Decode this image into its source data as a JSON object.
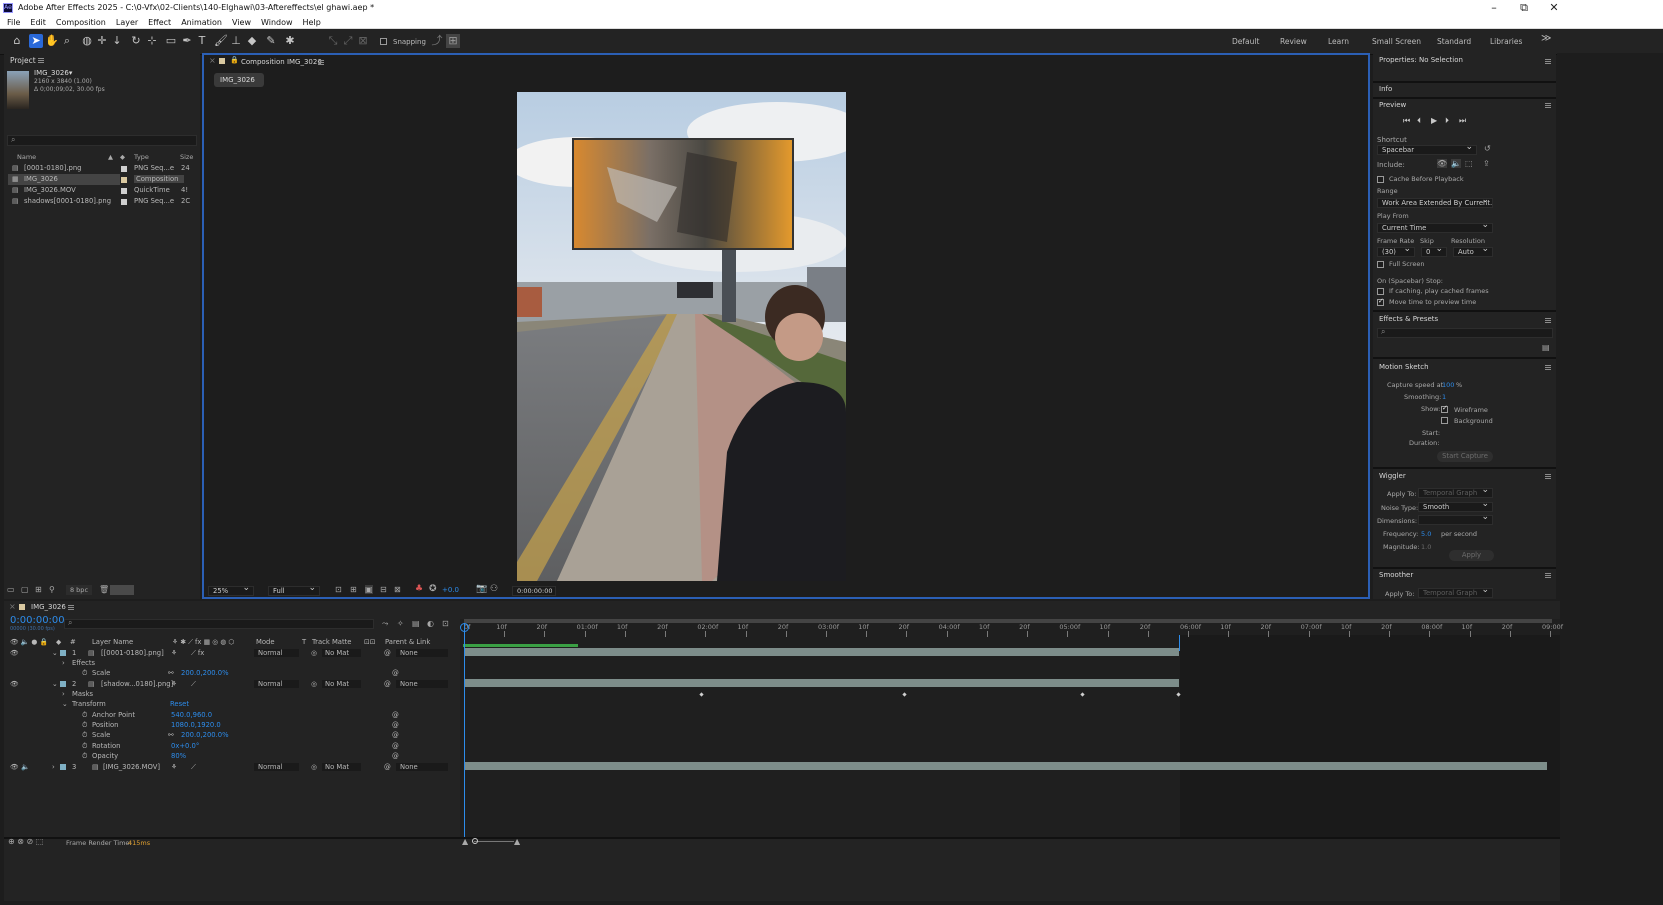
{
  "title_bar": {
    "text": "Adobe After Effects 2025 - C:\\0-Vfx\\02-Clients\\140-Elghawi\\03-Aftereffects\\el ghawi.aep *",
    "app_icon": "Ae",
    "minimize": "–",
    "maximize": "⧉",
    "close": "✕"
  },
  "menu": [
    "File",
    "Edit",
    "Composition",
    "Layer",
    "Effect",
    "Animation",
    "View",
    "Window",
    "Help"
  ],
  "toolbar": {
    "snapping_label": "Snapping",
    "workspaces": [
      "Default",
      "Review",
      "Learn",
      "Small Screen",
      "Standard",
      "Libraries"
    ],
    "more": "≫"
  },
  "project": {
    "title": "Project",
    "item_name": "IMG_3026▾",
    "item_dims": "2160 x 3840 (1.00)",
    "item_duration": "Δ 0;00;09;02, 30.00 fps",
    "search_placeholder": "",
    "columns": {
      "name": "Name",
      "type": "Type",
      "size": "Size"
    },
    "rows": [
      {
        "name": "[0001-0180].png",
        "type": "PNG Seq...e",
        "size": "24",
        "color": "#cfcfcf"
      },
      {
        "name": "IMG_3026",
        "type": "Composition",
        "size": "",
        "color": "#d9c8a0"
      },
      {
        "name": "IMG_3026.MOV",
        "type": "QuickTime",
        "size": "4!",
        "color": "#cfcfcf"
      },
      {
        "name": "shadows[0001-0180].png",
        "type": "PNG Seq...e",
        "size": "2C",
        "color": "#cfcfcf"
      }
    ],
    "bpc": "8 bpc"
  },
  "composition": {
    "tab": "Composition IMG_3026",
    "sub_tab": "IMG_3026",
    "zoom": "25%",
    "resolution": "Full",
    "exposure": "+0.0",
    "timecode": "0:00:00:00"
  },
  "right": {
    "properties": "Properties: No Selection",
    "info": "Info",
    "preview": {
      "title": "Preview",
      "shortcut_label": "Shortcut",
      "shortcut": "Spacebar",
      "include_label": "Include:",
      "cache_before": "Cache Before Playback",
      "range_label": "Range",
      "range": "Work Area Extended By Current...",
      "play_from_label": "Play From",
      "play_from": "Current Time",
      "frame_rate_label": "Frame Rate",
      "skip_label": "Skip",
      "resolution_label": "Resolution",
      "frame_rate": "(30)",
      "skip": "0",
      "resolution": "Auto",
      "full_screen": "Full Screen",
      "on_stop": "On (Spacebar) Stop:",
      "if_caching": "If caching, play cached frames",
      "move_time": "Move time to preview time"
    },
    "effects": {
      "title": "Effects & Presets"
    },
    "motion_sketch": {
      "title": "Motion Sketch",
      "capture_label": "Capture speed at:",
      "capture_value": "100",
      "capture_unit": "%",
      "smoothing_label": "Smoothing:",
      "smoothing_value": "1",
      "show_label": "Show:",
      "wireframe": "Wireframe",
      "background": "Background",
      "start_label": "Start:",
      "duration_label": "Duration:",
      "start_capture": "Start Capture"
    },
    "wiggler": {
      "title": "Wiggler",
      "apply_to_label": "Apply To:",
      "apply_to": "Temporal Graph",
      "noise_label": "Noise Type:",
      "noise": "Smooth",
      "dimensions_label": "Dimensions:",
      "frequency_label": "Frequency:",
      "frequency": "5.0",
      "per_second": "per second",
      "magnitude_label": "Magnitude:",
      "magnitude": "1.0",
      "apply": "Apply"
    },
    "smoother": {
      "title": "Smoother",
      "apply_to_label": "Apply To:",
      "apply_to": "Temporal Graph"
    }
  },
  "timeline": {
    "tab": "IMG_3026",
    "timecode": "0:00:00:00",
    "timecode_sub": "00000 (30.00 fps)",
    "columns": {
      "num": "#",
      "layer_name": "Layer Name",
      "mode": "Mode",
      "t": "T",
      "track_matte": "Track Matte",
      "parent": "Parent & Link"
    },
    "ruler": [
      "0f",
      "10f",
      "20f",
      "01:00f",
      "10f",
      "20f",
      "02:00f",
      "10f",
      "20f",
      "03:00f",
      "10f",
      "20f",
      "04:00f",
      "10f",
      "20f",
      "05:00f",
      "10f",
      "20f",
      "06:00f",
      "10f",
      "20f",
      "07:00f",
      "10f",
      "20f",
      "08:00f",
      "10f",
      "20f",
      "09:00f"
    ],
    "layers": [
      {
        "num": "1",
        "name": "[[0001-0180].png]",
        "mode": "Normal",
        "matte": "No Mat",
        "parent": "None"
      },
      {
        "num": "2",
        "name": "[shadow...0180].png]",
        "mode": "Normal",
        "matte": "No Mat",
        "parent": "None"
      },
      {
        "num": "3",
        "name": "[IMG_3026.MOV]",
        "mode": "Normal",
        "matte": "No Mat",
        "parent": "None"
      }
    ],
    "effects_label": "Effects",
    "scale_label": "Scale",
    "scale_value_1": "200.0,200.0%",
    "masks_label": "Masks",
    "transform_label": "Transform",
    "reset": "Reset",
    "anchor_label": "Anchor Point",
    "anchor_value": "540.0,960.0",
    "position_label": "Position",
    "position_value": "1080.0,1920.0",
    "scale_value_2": "200.0,200.0%",
    "rotation_label": "Rotation",
    "rotation_value": "0x+0.0°",
    "opacity_label": "Opacity",
    "opacity_value": "80%",
    "render_label": "Frame Render Time:",
    "render_value": "415ms"
  }
}
